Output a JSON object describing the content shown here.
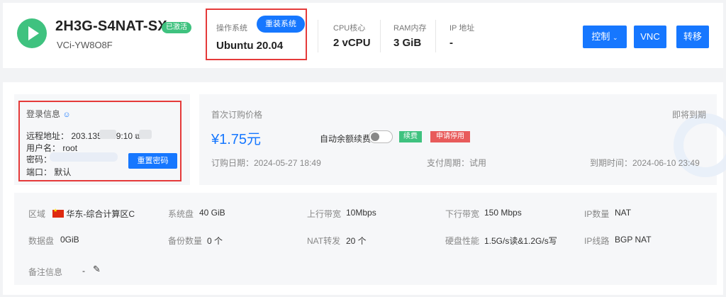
{
  "server": {
    "name": "2H3G-S4NAT-SX",
    "status_badge": "已激活",
    "instance_id": "VCi-YW8O8F"
  },
  "os": {
    "label": "操作系统",
    "reinstall_button": "重装系统",
    "value": "Ubuntu 20.04"
  },
  "cpu": {
    "label": "CPU核心",
    "value": "2 vCPU"
  },
  "ram": {
    "label": "RAM内存",
    "value": "3 GiB"
  },
  "ip": {
    "label": "IP 地址",
    "value": "-"
  },
  "actions": {
    "control": "控制",
    "vnc": "VNC",
    "transfer": "转移"
  },
  "login": {
    "title": "登录信息",
    "remote_label": "远程地址：",
    "remote_value": "203.135.   189:10",
    "user_label": "用户名：",
    "user_value": "root",
    "password_label": "密码：",
    "port_label": "端口：",
    "port_value": "默认",
    "reset_button": "重置密码"
  },
  "billing": {
    "first_price_label": "首次订购价格",
    "expiring_label": "即将到期",
    "price": "¥1.75元",
    "auto_renew_label": "自动余额续费",
    "renew_tag": "续费",
    "cancel_tag": "申请停用",
    "order_date": "订购日期：2024-05-27 18:49",
    "pay_cycle": "支付周期：试用",
    "expire_time": "到期时间：2024-06-10 23:49"
  },
  "specs": {
    "region_label": "区域",
    "region_value": "华东-综合计算区C",
    "sysdisk_label": "系统盘",
    "sysdisk_value": "40 GiB",
    "up_label": "上行带宽",
    "up_value": "10Mbps",
    "down_label": "下行带宽",
    "down_value": "150 Mbps",
    "ipcount_label": "IP数量",
    "ipcount_value": "NAT",
    "datadisk_label": "数据盘",
    "datadisk_value": "0GiB",
    "backup_label": "备份数量",
    "backup_value": "0 个",
    "natfwd_label": "NAT转发",
    "natfwd_value": "20 个",
    "diskperf_label": "硬盘性能",
    "diskperf_value": "1.5G/s读&1.2G/s写",
    "ipline_label": "IP线路",
    "ipline_value": "BGP NAT",
    "note_label": "备注信息",
    "note_value": "-"
  },
  "colors": {
    "accent": "#1677ff",
    "active": "#3fc27f",
    "highlight": "#e53a3a"
  }
}
